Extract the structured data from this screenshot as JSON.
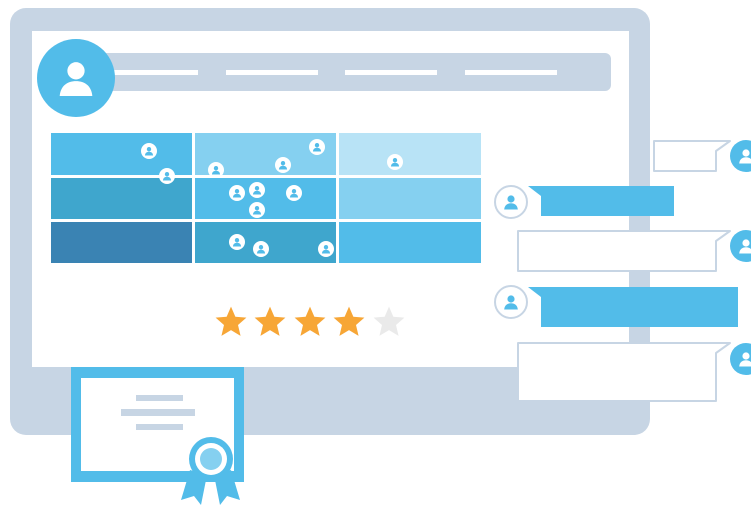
{
  "colors": {
    "frame": "#c7d5e4",
    "screen": "#ffffff",
    "nav_bar": "#c7d5e4",
    "nav_line": "#ffffff",
    "avatar_blue": "#52bce9",
    "grid_dark": "#3a83b3",
    "grid_mid": "#3fa6cd",
    "grid_base": "#52bce9",
    "grid_light": "#85d0f0",
    "grid_pale": "#b8e3f6",
    "star_filled": "#f7a636",
    "star_empty": "#eaeaea",
    "chat_border": "#c7d5e4",
    "chat_blue": "#52bce9",
    "certificate": "#52bce9",
    "certificate_lines": "#c7d5e4"
  },
  "rating": {
    "value": 4,
    "max": 5
  },
  "icons": {
    "avatar": "user-icon",
    "star": "star-icon",
    "ribbon": "award-ribbon-icon"
  }
}
